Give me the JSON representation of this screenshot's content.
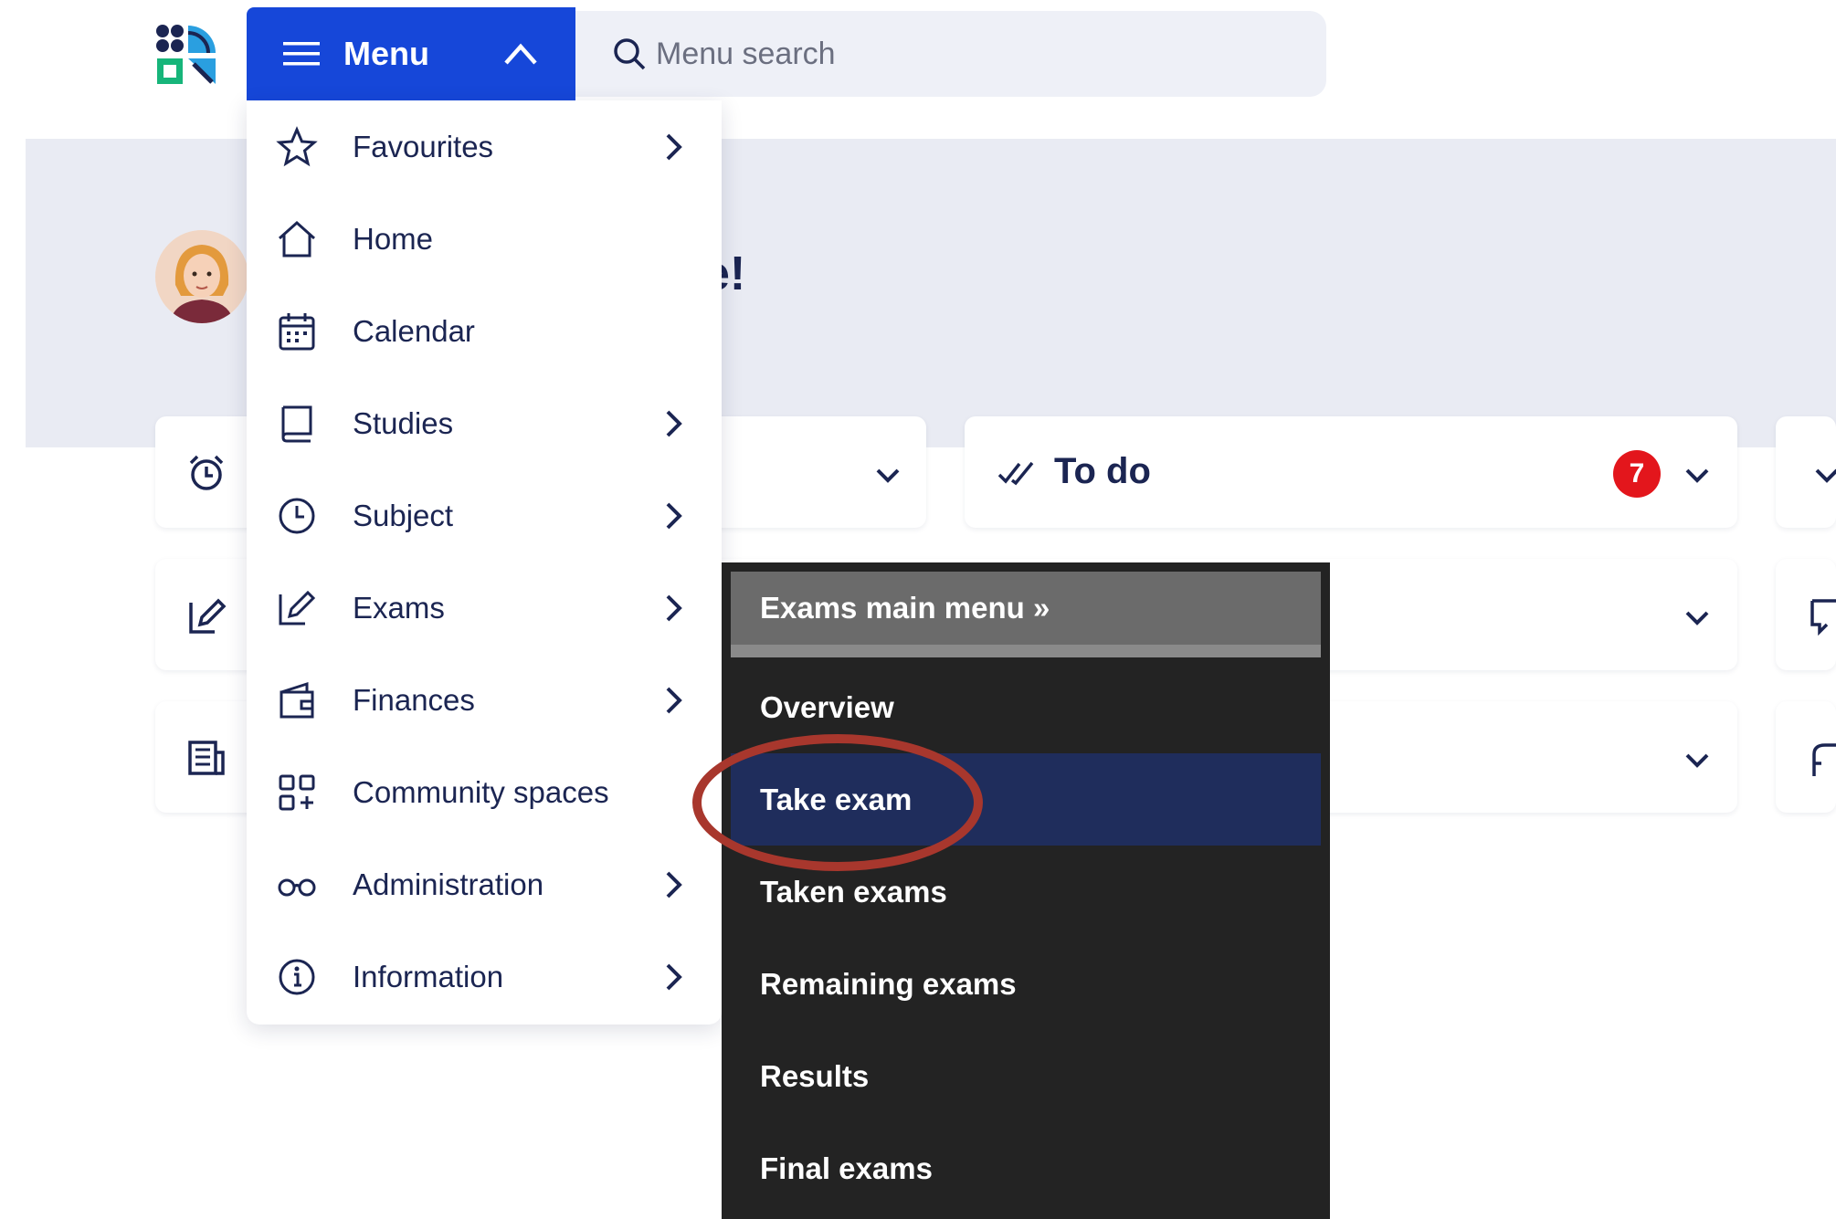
{
  "header": {
    "menu_label": "Menu",
    "search_placeholder": "Menu search"
  },
  "hero": {
    "greeting_fragment": "e!"
  },
  "cards": {
    "todo": {
      "title": "To do",
      "badge_count": "7"
    }
  },
  "menu": {
    "items": [
      {
        "label": "Favourites",
        "icon": "star-icon",
        "has_submenu": true
      },
      {
        "label": "Home",
        "icon": "home-icon",
        "has_submenu": false
      },
      {
        "label": "Calendar",
        "icon": "calendar-icon",
        "has_submenu": false
      },
      {
        "label": "Studies",
        "icon": "book-icon",
        "has_submenu": true
      },
      {
        "label": "Subject",
        "icon": "clock-icon",
        "has_submenu": true
      },
      {
        "label": "Exams",
        "icon": "edit-icon",
        "has_submenu": true
      },
      {
        "label": "Finances",
        "icon": "wallet-icon",
        "has_submenu": true
      },
      {
        "label": "Community spaces",
        "icon": "apps-icon",
        "has_submenu": false
      },
      {
        "label": "Administration",
        "icon": "glasses-icon",
        "has_submenu": true
      },
      {
        "label": "Information",
        "icon": "info-icon",
        "has_submenu": true
      }
    ]
  },
  "exams_submenu": {
    "header": "Exams main menu »",
    "items": [
      {
        "label": "Overview",
        "active": false
      },
      {
        "label": "Take exam",
        "active": true
      },
      {
        "label": "Taken exams",
        "active": false
      },
      {
        "label": "Remaining exams",
        "active": false
      },
      {
        "label": "Results",
        "active": false
      },
      {
        "label": "Final exams",
        "active": false
      }
    ]
  },
  "colors": {
    "primary": "#1647d9",
    "navy_text": "#1b2552",
    "submenu_bg": "#232323",
    "submenu_active": "#1f2d5c",
    "badge_red": "#e3161c",
    "highlight_ring": "#a8372d",
    "hero_bg": "#e9ebf3"
  }
}
